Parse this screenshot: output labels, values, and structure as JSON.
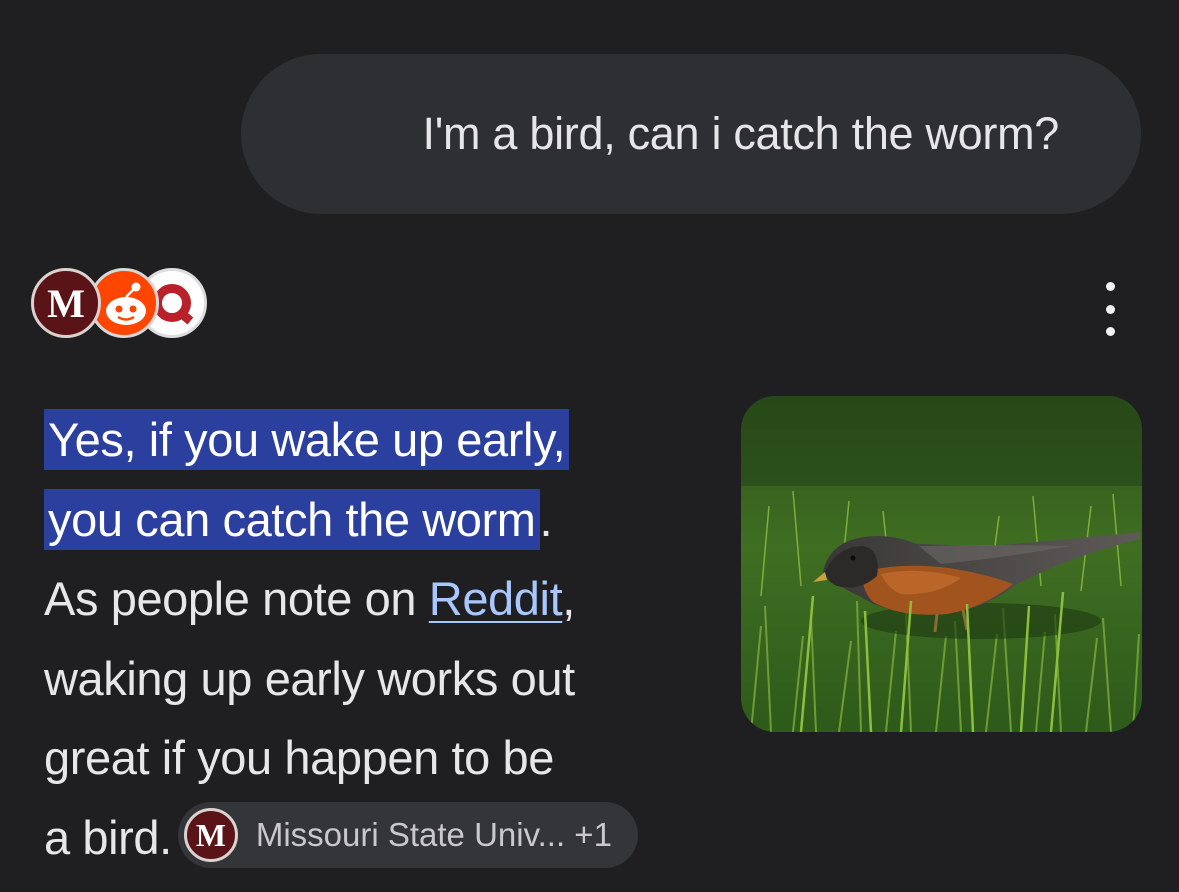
{
  "user_message": {
    "text": "I'm a bird, can i catch the worm?"
  },
  "sources": {
    "icons": [
      "missouri-state-logo",
      "reddit-logo",
      "quora-logo"
    ],
    "missouri_letter": "M"
  },
  "answer": {
    "highlight_line1": "Yes, if you wake up early,",
    "highlight_line2": "you can catch the worm",
    "period": ".",
    "line3_prefix": "As people note on ",
    "link_text": "Reddit",
    "line3_suffix": ",",
    "line4": "waking up early works out",
    "line5": "great if you happen to be",
    "line6": "a bird."
  },
  "citation": {
    "letter": "M",
    "label": "Missouri State Univ... +1"
  },
  "colors": {
    "background": "#1f1f21",
    "bubble": "#2d2f33",
    "highlight": "#2b3f9e",
    "link": "#a9c7ff",
    "chip": "#333539"
  },
  "image": {
    "subject": "robin-on-grass"
  }
}
